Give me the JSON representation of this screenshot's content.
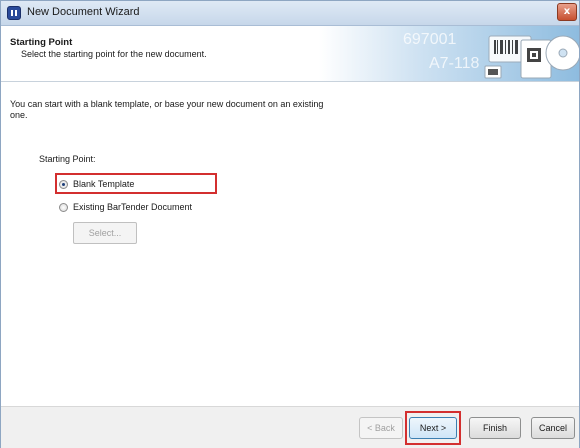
{
  "window": {
    "title": "New Document Wizard",
    "close_label": "x"
  },
  "header": {
    "title": "Starting Point",
    "subtitle": "Select the starting point for the new document.",
    "art_text_1": "697001",
    "art_text_2": "A7-118"
  },
  "body": {
    "intro": "You can start with a blank template, or base your new document on an existing one.",
    "starting_point_label": "Starting Point:",
    "options": [
      {
        "label": "Blank Template",
        "selected": true
      },
      {
        "label": "Existing BarTender Document",
        "selected": false
      }
    ],
    "select_button": "Select..."
  },
  "footer": {
    "back": "< Back",
    "next": "Next >",
    "finish": "Finish",
    "cancel": "Cancel"
  },
  "colors": {
    "highlight": "#d32f2f",
    "header_accent": "#8ebcdf"
  }
}
